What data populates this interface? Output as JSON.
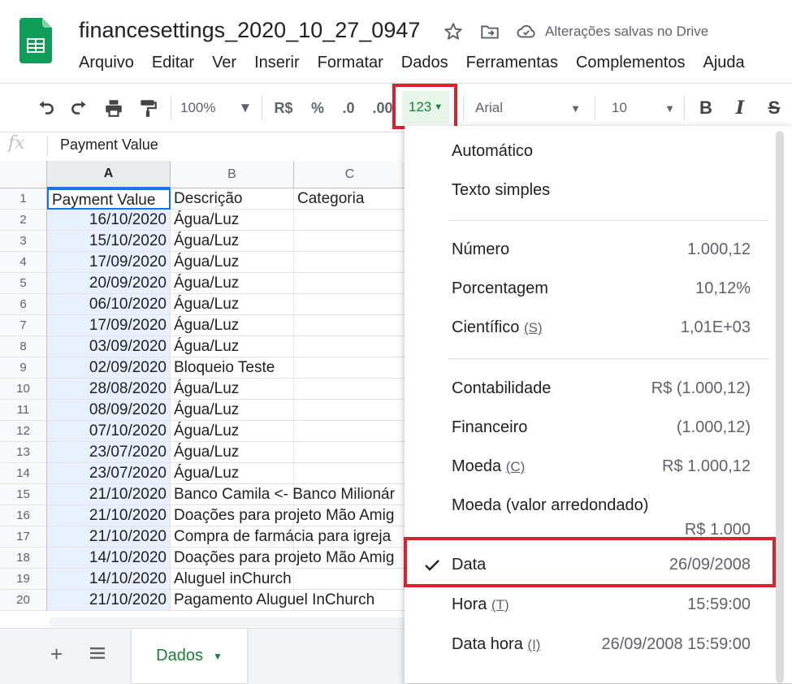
{
  "doc": {
    "title": "financesettings_2020_10_27_0947",
    "saved_status": "Alterações salvas no Drive"
  },
  "menu": [
    "Arquivo",
    "Editar",
    "Ver",
    "Inserir",
    "Formatar",
    "Dados",
    "Ferramentas",
    "Complementos",
    "Ajuda"
  ],
  "toolbar": {
    "zoom": "100%",
    "currency": "R$",
    "percent": "%",
    "decrease_decimals": ".0",
    "increase_decimals": ".00",
    "more_formats": "123",
    "font": "Arial",
    "font_size": "10",
    "bold": "B",
    "italic": "I",
    "strike": "S"
  },
  "formula_bar": {
    "fx": "fx",
    "content": "Payment Value"
  },
  "columns": [
    "A",
    "B",
    "C"
  ],
  "rows": [
    {
      "n": "1",
      "a": "Payment Value",
      "b": "Descrição",
      "c": "Categoria"
    },
    {
      "n": "2",
      "a": "16/10/2020",
      "b": "Água/Luz",
      "c": ""
    },
    {
      "n": "3",
      "a": "15/10/2020",
      "b": "Água/Luz",
      "c": ""
    },
    {
      "n": "4",
      "a": "17/09/2020",
      "b": "Água/Luz",
      "c": ""
    },
    {
      "n": "5",
      "a": "20/09/2020",
      "b": "Água/Luz",
      "c": ""
    },
    {
      "n": "6",
      "a": "06/10/2020",
      "b": "Água/Luz",
      "c": ""
    },
    {
      "n": "7",
      "a": "17/09/2020",
      "b": "Água/Luz",
      "c": ""
    },
    {
      "n": "8",
      "a": "03/09/2020",
      "b": "Água/Luz",
      "c": ""
    },
    {
      "n": "9",
      "a": "02/09/2020",
      "b": "Bloqueio Teste",
      "c": ""
    },
    {
      "n": "10",
      "a": "28/08/2020",
      "b": "Água/Luz",
      "c": ""
    },
    {
      "n": "11",
      "a": "08/09/2020",
      "b": "Água/Luz",
      "c": ""
    },
    {
      "n": "12",
      "a": "07/10/2020",
      "b": "Água/Luz",
      "c": ""
    },
    {
      "n": "13",
      "a": "23/07/2020",
      "b": "Água/Luz",
      "c": ""
    },
    {
      "n": "14",
      "a": "23/07/2020",
      "b": "Água/Luz",
      "c": ""
    },
    {
      "n": "15",
      "a": "21/10/2020",
      "b": "Banco Camila <- Banco Milionár",
      "c": ""
    },
    {
      "n": "16",
      "a": "21/10/2020",
      "b": "Doações para projeto Mão Amig",
      "c": ""
    },
    {
      "n": "17",
      "a": "21/10/2020",
      "b": "Compra de farmácia para igreja",
      "c": ""
    },
    {
      "n": "18",
      "a": "14/10/2020",
      "b": "Doações para projeto Mão Amig",
      "c": ""
    },
    {
      "n": "19",
      "a": "14/10/2020",
      "b": "Aluguel inChurch",
      "c": ""
    },
    {
      "n": "20",
      "a": "21/10/2020",
      "b": "Pagamento Aluguel InChurch",
      "c": ""
    }
  ],
  "sheet_tab": "Dados",
  "format_menu": {
    "automatic": "Automático",
    "plain_text": "Texto simples",
    "number": {
      "label": "Número",
      "example": "1.000,12"
    },
    "percent": {
      "label": "Porcentagem",
      "example": "10,12%"
    },
    "scientific": {
      "label": "Científico",
      "shortcut": "(S)",
      "example": "1,01E+03"
    },
    "accounting": {
      "label": "Contabilidade",
      "example": "R$ (1.000,12)"
    },
    "financial": {
      "label": "Financeiro",
      "example": "(1.000,12)"
    },
    "currency": {
      "label": "Moeda",
      "shortcut": "(C)",
      "example": "R$ 1.000,12"
    },
    "currency_rounded": {
      "label": "Moeda (valor arredondado)",
      "example": "R$ 1.000"
    },
    "date": {
      "label": "Data",
      "example": "26/09/2008",
      "checked": true
    },
    "time": {
      "label": "Hora",
      "shortcut": "(T)",
      "example": "15:59:00"
    },
    "datetime": {
      "label": "Data hora",
      "shortcut": "(I)",
      "example": "26/09/2008 15:59:00"
    }
  },
  "colors": {
    "highlight": "#d8222c",
    "green": "#188038",
    "selection_blue": "#1a73e8"
  }
}
